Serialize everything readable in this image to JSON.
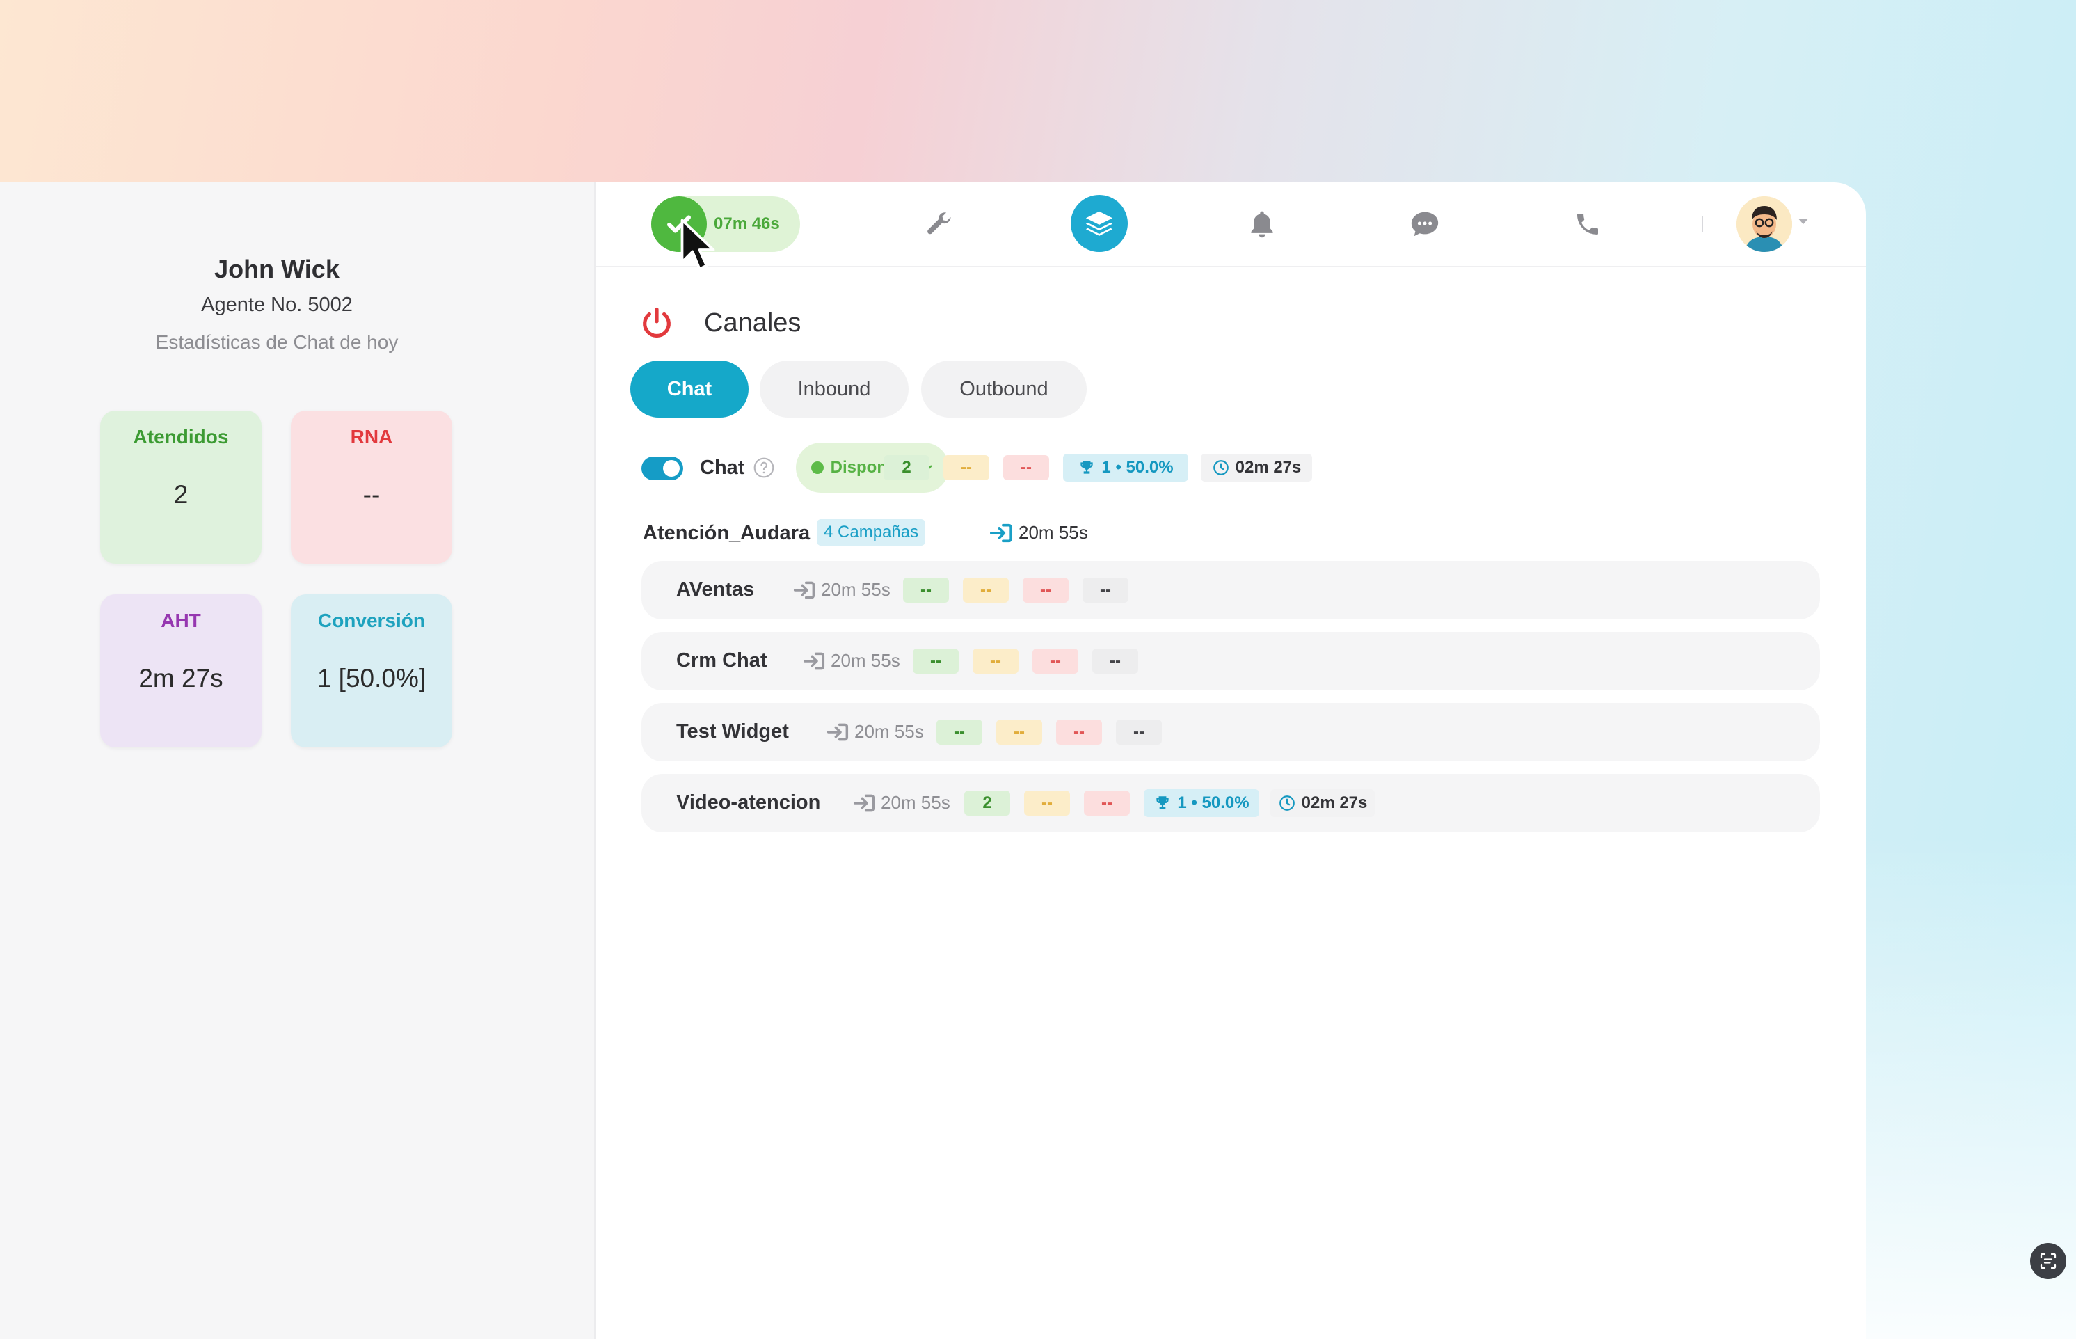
{
  "agent": {
    "name": "John Wick",
    "number": "Agente No. 5002",
    "subtitle": "Estadísticas de Chat de hoy"
  },
  "stats": {
    "attended": {
      "label": "Atendidos",
      "value": "2"
    },
    "rna": {
      "label": "RNA",
      "value": "--"
    },
    "aht": {
      "label": "AHT",
      "value": "2m 27s"
    },
    "conversion": {
      "label": "Conversión",
      "value": "1 [50.0%]"
    }
  },
  "topbar": {
    "status_timer": "07m 46s",
    "icons": [
      "check-icon",
      "wrench-icon",
      "layers-icon",
      "bell-icon",
      "chat-bubble-icon",
      "phone-icon",
      "avatar",
      "caret-down-icon"
    ]
  },
  "section": {
    "title": "Canales"
  },
  "tabs": [
    {
      "label": "Chat",
      "active": true
    },
    {
      "label": "Inbound",
      "active": false
    },
    {
      "label": "Outbound",
      "active": false
    }
  ],
  "channel": {
    "label": "Chat",
    "enabled": true,
    "status": "Disponible",
    "badges": {
      "green": "2",
      "yellow": "--",
      "red": "--",
      "trophy": "1 • 50.0%",
      "time": "02m 27s"
    }
  },
  "campaign_group": {
    "name": "Atención_Audara",
    "count_label": "4 Campañas",
    "login_time": "20m 55s"
  },
  "queues": [
    {
      "name": "AVentas",
      "login_time": "20m 55s",
      "green": "--",
      "yellow": "--",
      "red": "--",
      "extra": "--"
    },
    {
      "name": "Crm Chat",
      "login_time": "20m 55s",
      "green": "--",
      "yellow": "--",
      "red": "--",
      "extra": "--"
    },
    {
      "name": "Test Widget",
      "login_time": "20m 55s",
      "green": "--",
      "yellow": "--",
      "red": "--",
      "extra": "--"
    },
    {
      "name": "Video-atencion",
      "login_time": "20m 55s",
      "green": "2",
      "yellow": "--",
      "red": "--",
      "trophy": "1 • 50.0%",
      "time": "02m 27s"
    }
  ],
  "colors": {
    "accent": "#15a8c9",
    "status_green": "#4fb83f",
    "danger_red": "#e2393d"
  }
}
